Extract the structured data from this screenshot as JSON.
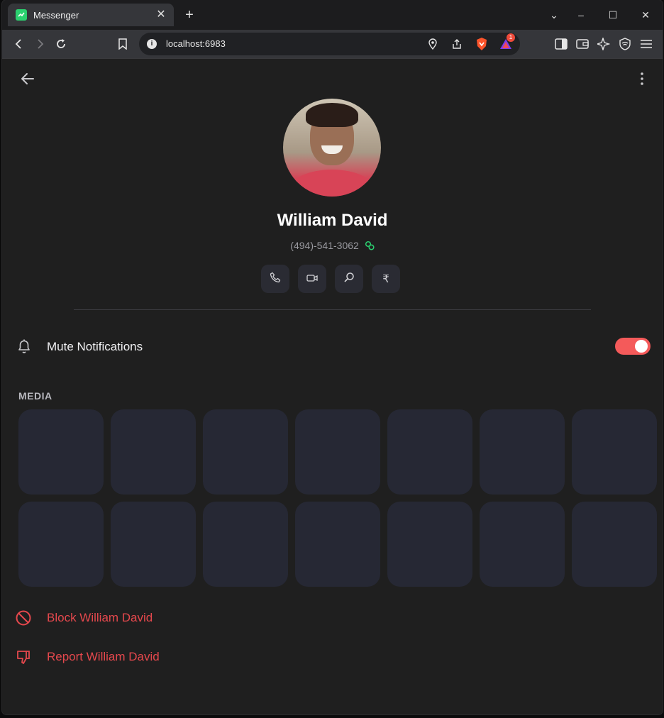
{
  "browser": {
    "tab_title": "Messenger",
    "url": "localhost:6983",
    "notification_count": "1"
  },
  "profile": {
    "name": "William David",
    "phone": "(494)-541-3062"
  },
  "settings": {
    "mute_label": "Mute Notifications",
    "mute_enabled": true
  },
  "media": {
    "title": "MEDIA",
    "tile_count": 14
  },
  "danger": {
    "block_label": "Block William David",
    "report_label": "Report William David"
  },
  "colors": {
    "accent": "#f45a5a",
    "danger": "#e5484d",
    "verified": "#2bd06f",
    "tile": "#262834"
  }
}
